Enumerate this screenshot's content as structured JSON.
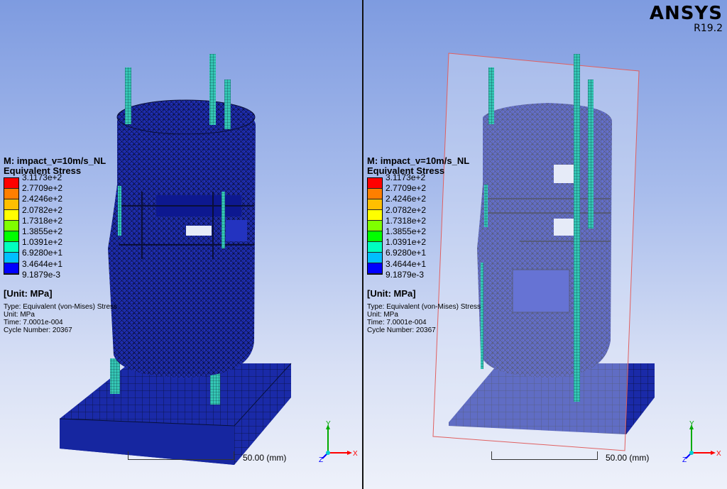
{
  "brand": {
    "name": "ANSYS",
    "version": "R19.2"
  },
  "result": {
    "title": "M: impact_v=10m/s_NL",
    "subtitle": "Equivalent Stress",
    "unit_label": "[Unit: MPa]",
    "info_type": "Type: Equivalent (von-Mises) Stress",
    "info_unit": "Unit: MPa",
    "info_time": "Time: 7.0001e-004",
    "info_cycle": "Cycle Number: 20367"
  },
  "legend": {
    "labels": [
      "3.1173e+2",
      "2.7709e+2",
      "2.4246e+2",
      "2.0782e+2",
      "1.7318e+2",
      "1.3855e+2",
      "1.0391e+2",
      "6.9280e+1",
      "3.4644e+1",
      "9.1879e-3"
    ],
    "colors": [
      "#ff0000",
      "#ff7f00",
      "#ffbf00",
      "#ffff00",
      "#7fff00",
      "#00ff00",
      "#00ffbf",
      "#00bfff",
      "#0055ff",
      "#0000ff"
    ]
  },
  "scale": {
    "label": "50.00  (mm)"
  },
  "triad": {
    "x": "X",
    "y": "Y",
    "z": "Z"
  },
  "colors": {
    "mesh_body": "#1f2fb8",
    "mesh_line": "#0a0f3a",
    "rebar": "#34c7b5",
    "section_plane": "#e06060"
  }
}
